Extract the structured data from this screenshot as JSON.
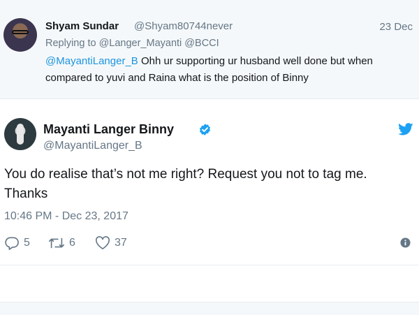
{
  "reply_tweet": {
    "author_name": "Shyam Sundar",
    "author_handle": "@Shyam80744never",
    "date": "23 Dec",
    "replying_prefix": "Replying to",
    "replying_to": "@Langer_Mayanti @BCCI",
    "mention": "@MayantiLanger_B",
    "text": "Ohh ur supporting ur husband well done but when compared to yuvi and Raina what is the position of Binny"
  },
  "main_tweet": {
    "author_name": "Mayanti Langer Binny",
    "author_handle": "@MayantiLanger_B",
    "text": "You do realise that’s not me right? Request you not to tag me. Thanks",
    "timestamp": "10:46 PM - Dec 23, 2017",
    "replies": "5",
    "retweets": "6",
    "likes": "37"
  },
  "icons": {
    "verified": "verified-badge-icon",
    "bird": "twitter-bird-icon",
    "reply": "reply-icon",
    "retweet": "retweet-icon",
    "like": "heart-icon",
    "info": "info-icon"
  },
  "colors": {
    "brand_blue": "#1da1f2",
    "link_blue": "#1b95e0",
    "secondary_text": "#657786",
    "primary_text": "#14171a",
    "reply_background": "#f5f8fa"
  }
}
